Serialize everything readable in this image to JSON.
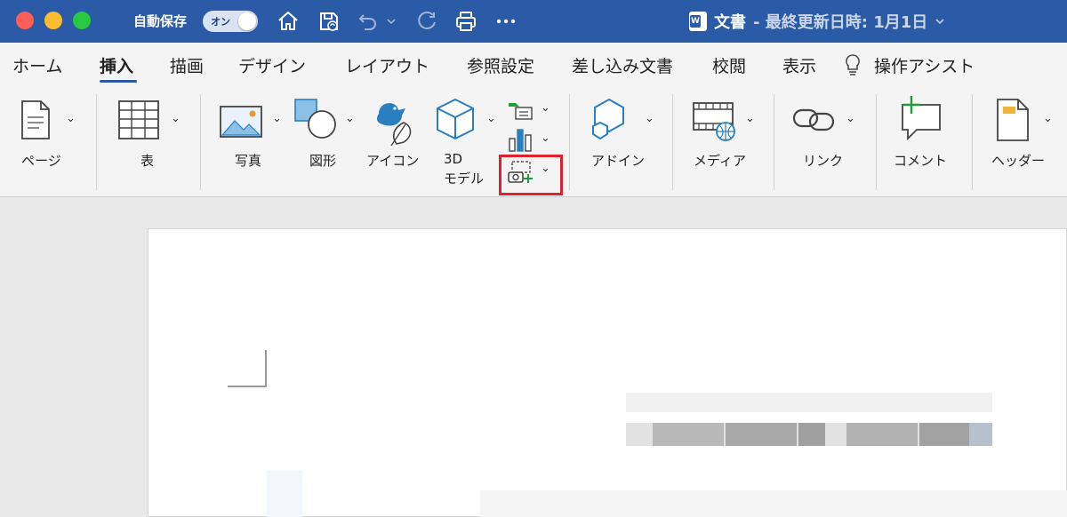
{
  "titlebar": {
    "autosave_label": "自動保存",
    "toggle_label": "オン",
    "document_title": "文書",
    "title_suffix": "- 最終更新日時: 1月1日",
    "icons": [
      "home-icon",
      "save-icon",
      "undo-icon",
      "redo-icon",
      "print-icon",
      "more-icon"
    ]
  },
  "tabs": [
    "ホーム",
    "挿入",
    "描画",
    "デザイン",
    "レイアウト",
    "参照設定",
    "差し込み文書",
    "校閲",
    "表示",
    "操作アシスト"
  ],
  "active_tab": "挿入",
  "ribbon": {
    "page": "ページ",
    "table": "表",
    "photo": "写真",
    "shapes": "図形",
    "icons": "アイコン",
    "model3d_line1": "3D",
    "model3d_line2": "モデル",
    "addins": "アドイン",
    "media": "メディア",
    "link": "リンク",
    "comment": "コメント",
    "header": "ヘッダー"
  },
  "colors": {
    "titlebar": "#2b5aa6",
    "ribbon_bg": "#f4f4f4",
    "icon_blue": "#2a7fc1",
    "highlight": "#e0202a",
    "comment_plus": "#1e9e3a"
  }
}
